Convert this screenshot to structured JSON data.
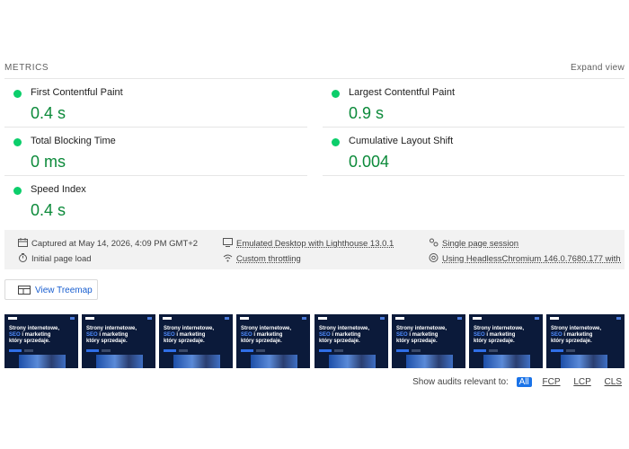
{
  "metrics_section": {
    "title": "METRICS",
    "expand_label": "Expand view",
    "status_color": "#0cce6b",
    "value_color": "#0c8a3a",
    "items": [
      {
        "label": "First Contentful Paint",
        "value": "0.4 s"
      },
      {
        "label": "Largest Contentful Paint",
        "value": "0.9 s"
      },
      {
        "label": "Total Blocking Time",
        "value": "0 ms"
      },
      {
        "label": "Cumulative Layout Shift",
        "value": "0.004"
      },
      {
        "label": "Speed Index",
        "value": "0.4 s"
      }
    ]
  },
  "run_info": {
    "captured": "Captured at May 14, 2026, 4:09 PM GMT+2",
    "initial_load": "Initial page load",
    "emulation": "Emulated Desktop with Lighthouse 13.0.1",
    "throttling": "Custom throttling",
    "session": "Single page session",
    "browser": "Using HeadlessChromium 146.0.7680.177 with lr"
  },
  "treemap": {
    "label": "View Treemap",
    "icon": "treemap-icon"
  },
  "filmstrip": {
    "frame_count": 8,
    "frame_heading_line1": "Strony internetowe,",
    "frame_heading_blue": "SEO",
    "frame_heading_line2_rest": "i marketing",
    "frame_heading_line3": "który sprzedaje."
  },
  "audits_filter": {
    "label": "Show audits relevant to:",
    "options": [
      "All",
      "FCP",
      "LCP",
      "CLS"
    ],
    "active": "All",
    "accent_color": "#1a73e8"
  }
}
